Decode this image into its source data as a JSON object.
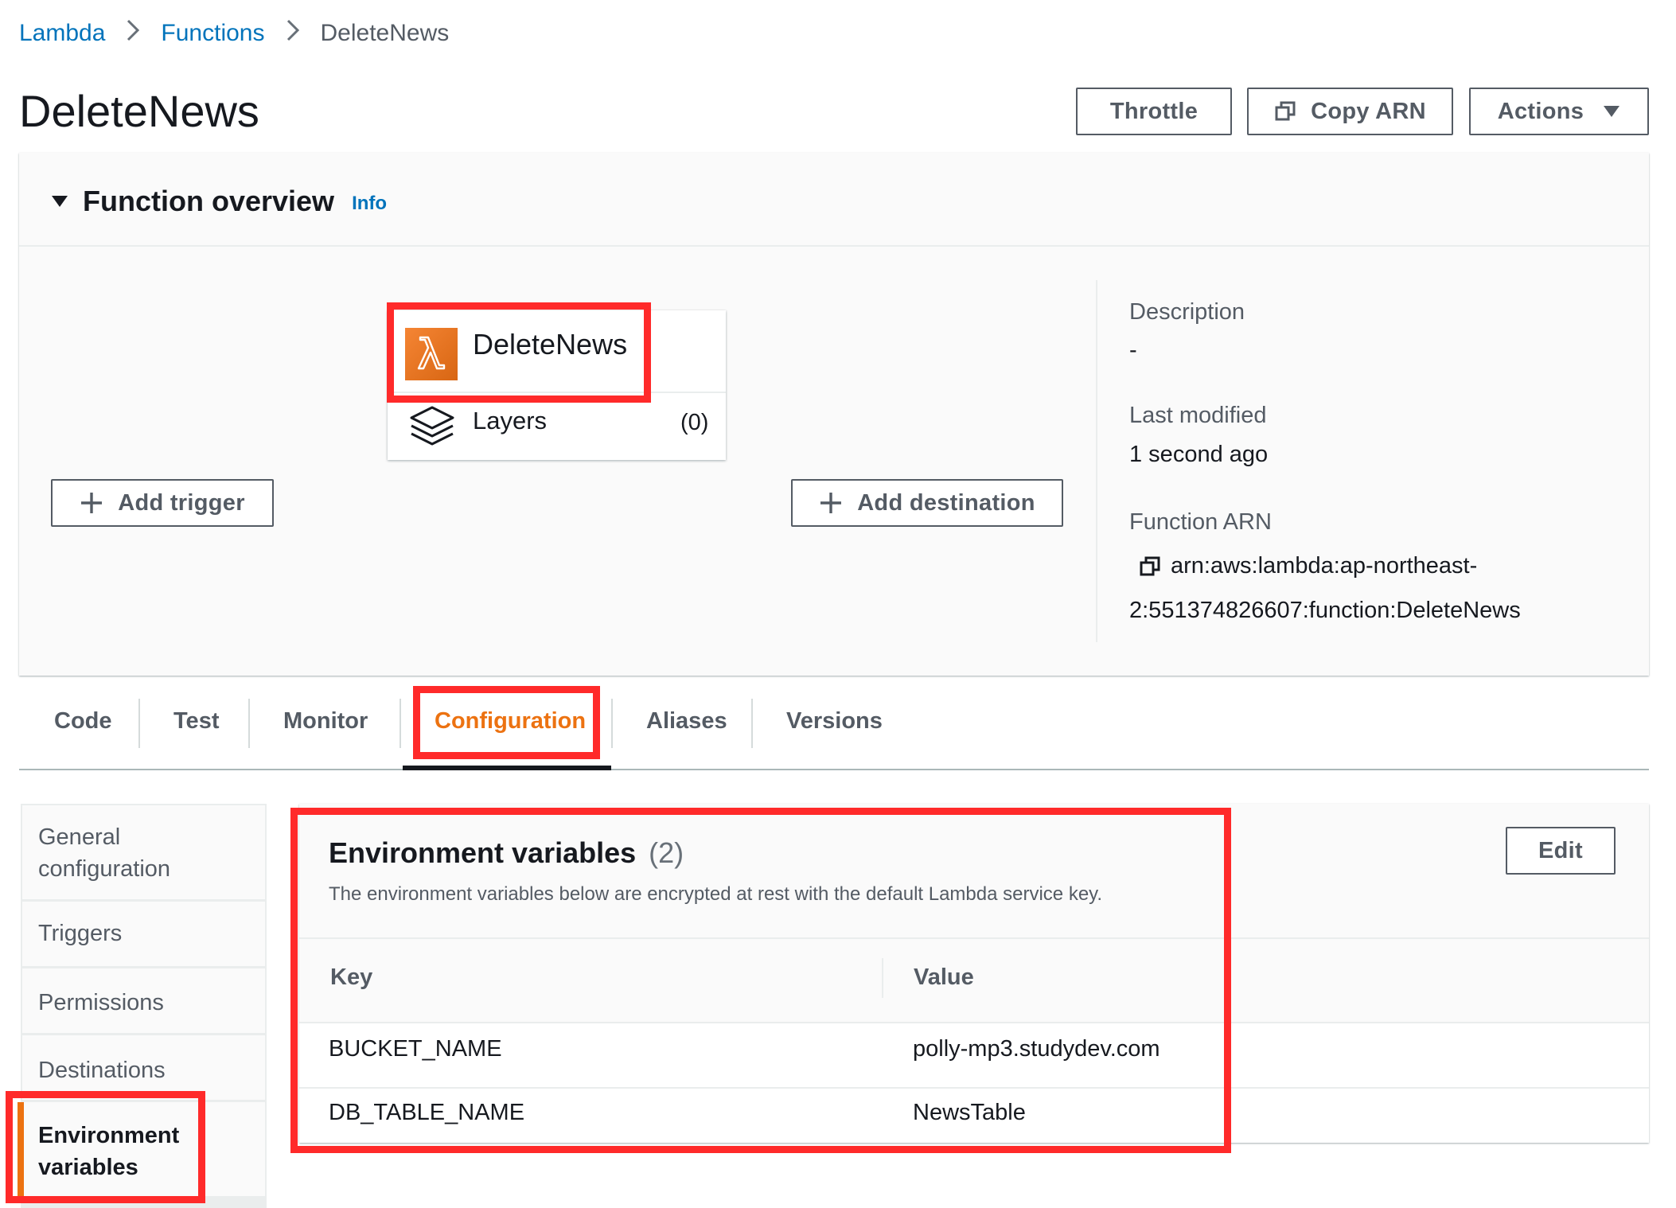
{
  "breadcrumb": {
    "items": [
      "Lambda",
      "Functions"
    ],
    "current": "DeleteNews"
  },
  "page": {
    "title": "DeleteNews"
  },
  "header_actions": {
    "throttle": "Throttle",
    "copy_arn": "Copy ARN",
    "actions": "Actions"
  },
  "overview": {
    "title": "Function overview",
    "info": "Info",
    "function_name": "DeleteNews",
    "layers_label": "Layers",
    "layers_count": "(0)",
    "add_trigger": "Add trigger",
    "add_destination": "Add destination",
    "description_label": "Description",
    "description_value": "-",
    "last_modified_label": "Last modified",
    "last_modified_value": "1 second ago",
    "arn_label": "Function ARN",
    "arn_line1": "arn:aws:lambda:ap-northeast-",
    "arn_line2": "2:551374826607:function:DeleteNews"
  },
  "tabs": [
    "Code",
    "Test",
    "Monitor",
    "Configuration",
    "Aliases",
    "Versions"
  ],
  "active_tab": "Configuration",
  "sidebar": {
    "items": [
      {
        "label_line1": "General",
        "label_line2": "configuration"
      },
      {
        "label": "Triggers"
      },
      {
        "label": "Permissions"
      },
      {
        "label": "Destinations"
      },
      {
        "label_line1": "Environment",
        "label_line2": "variables",
        "active": true
      }
    ]
  },
  "env": {
    "title": "Environment variables",
    "count": "(2)",
    "subtitle": "The environment variables below are encrypted at rest with the default Lambda service key.",
    "edit": "Edit",
    "columns": {
      "key": "Key",
      "value": "Value"
    },
    "rows": [
      {
        "key": "BUCKET_NAME",
        "value": "polly-mp3.studydev.com"
      },
      {
        "key": "DB_TABLE_NAME",
        "value": "NewsTable"
      }
    ]
  },
  "colors": {
    "link": "#0073bb",
    "accent": "#ec7211",
    "highlight": "#ff2a2a",
    "lambda_icon": "#e8700f"
  }
}
